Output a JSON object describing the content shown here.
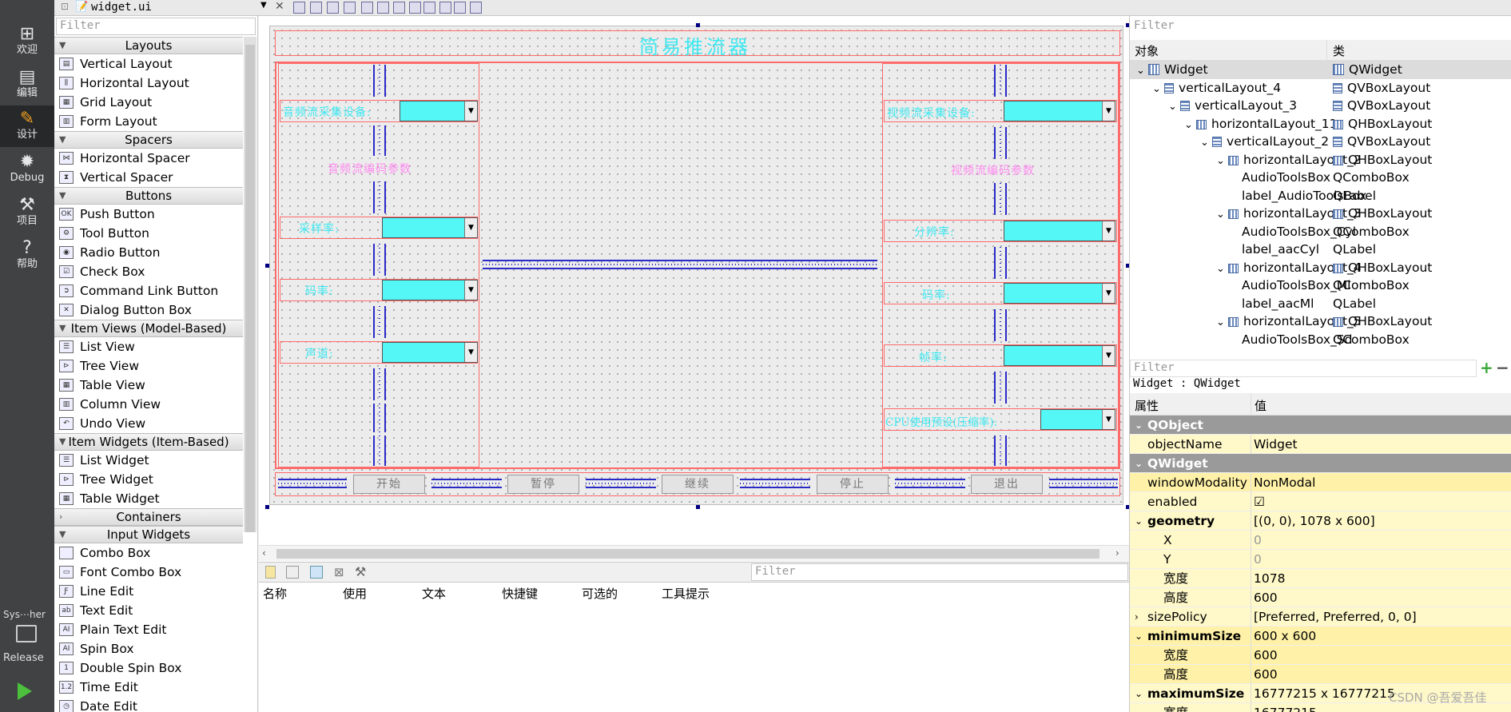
{
  "modebar": {
    "items": [
      {
        "icon": "grid-icon",
        "label": "欢迎"
      },
      {
        "icon": "edit-icon",
        "label": "编辑"
      },
      {
        "icon": "pencil-icon",
        "label": "设计"
      },
      {
        "icon": "bug-icon",
        "label": "Debug"
      },
      {
        "icon": "wrench-icon",
        "label": "项目"
      },
      {
        "icon": "help-icon",
        "label": "帮助"
      }
    ],
    "kit_label": "Sys⋯her",
    "build_label": "Release"
  },
  "topbar": {
    "file_name": "widget.ui"
  },
  "widgetbox": {
    "filter_placeholder": "Filter",
    "categories": [
      {
        "name": "Layouts",
        "items": [
          "Vertical Layout",
          "Horizontal Layout",
          "Grid Layout",
          "Form Layout"
        ]
      },
      {
        "name": "Spacers",
        "items": [
          "Horizontal Spacer",
          "Vertical Spacer"
        ]
      },
      {
        "name": "Buttons",
        "items": [
          "Push Button",
          "Tool Button",
          "Radio Button",
          "Check Box",
          "Command Link Button",
          "Dialog Button Box"
        ]
      },
      {
        "name": "Item Views (Model-Based)",
        "items": [
          "List View",
          "Tree View",
          "Table View",
          "Column View",
          "Undo View"
        ]
      },
      {
        "name": "Item Widgets (Item-Based)",
        "items": [
          "List Widget",
          "Tree Widget",
          "Table Widget"
        ]
      },
      {
        "name": "Containers",
        "items": []
      },
      {
        "name": "Input Widgets",
        "items": [
          "Combo Box",
          "Font Combo Box",
          "Line Edit",
          "Text Edit",
          "Plain Text Edit",
          "Spin Box",
          "Double Spin Box",
          "Time Edit",
          "Date Edit"
        ]
      }
    ]
  },
  "form": {
    "title": "简易推流器",
    "audio_device_label": "音频流采集设备:",
    "audio_params_label": "音频流编码参数",
    "sample_rate_label": "采样率:",
    "audio_bitrate_label": "码率:",
    "channels_label": "声道:",
    "video_device_label": "视频流采集设备:",
    "video_params_label": "视频流编码参数",
    "resolution_label": "分辨率:",
    "video_bitrate_label": "码率:",
    "framerate_label": "帧率:",
    "cpu_label": "CPU使用预设(压缩率):",
    "buttons": [
      "开始",
      "暂停",
      "继续",
      "停止",
      "退出"
    ]
  },
  "actioneditor": {
    "filter_placeholder": "Filter",
    "columns": [
      "名称",
      "使用",
      "文本",
      "快捷键",
      "可选的",
      "工具提示"
    ]
  },
  "objectinspector": {
    "filter_placeholder": "Filter",
    "columns": [
      "对象",
      "类"
    ],
    "rows": [
      {
        "name": "Widget",
        "class": "QWidget"
      },
      {
        "name": "verticalLayout_4",
        "class": "QVBoxLayout"
      },
      {
        "name": "verticalLayout_3",
        "class": "QVBoxLayout"
      },
      {
        "name": "horizontalLayout_11",
        "class": "QHBoxLayout"
      },
      {
        "name": "verticalLayout_2",
        "class": "QVBoxLayout"
      },
      {
        "name": "horizontalLayout_2",
        "class": "QHBoxLayout"
      },
      {
        "name": "AudioToolsBox",
        "class": "QComboBox"
      },
      {
        "name": "label_AudioToolsBox",
        "class": "QLabel"
      },
      {
        "name": "horizontalLayout_3",
        "class": "QHBoxLayout"
      },
      {
        "name": "AudioToolsBox_Cyl",
        "class": "QComboBox"
      },
      {
        "name": "label_aacCyl",
        "class": "QLabel"
      },
      {
        "name": "horizontalLayout_4",
        "class": "QHBoxLayout"
      },
      {
        "name": "AudioToolsBox_Ml",
        "class": "QComboBox"
      },
      {
        "name": "label_aacMl",
        "class": "QLabel"
      },
      {
        "name": "horizontalLayout_5",
        "class": "QHBoxLayout"
      },
      {
        "name": "AudioToolsBox_Sd",
        "class": "QComboBox"
      }
    ]
  },
  "propertyeditor": {
    "filter_placeholder": "Filter",
    "caption": "Widget : QWidget",
    "columns": [
      "属性",
      "值"
    ],
    "rows": [
      {
        "name": "QObject",
        "value": ""
      },
      {
        "name": "objectName",
        "value": "Widget"
      },
      {
        "name": "QWidget",
        "value": ""
      },
      {
        "name": "windowModality",
        "value": "NonModal"
      },
      {
        "name": "enabled",
        "value": "☑"
      },
      {
        "name": "geometry",
        "value": "[(0, 0), 1078 x 600]"
      },
      {
        "name": "X",
        "value": "0"
      },
      {
        "name": "Y",
        "value": "0"
      },
      {
        "name": "宽度",
        "value": "1078"
      },
      {
        "name": "高度",
        "value": "600"
      },
      {
        "name": "sizePolicy",
        "value": "[Preferred, Preferred, 0, 0]"
      },
      {
        "name": "minimumSize",
        "value": "600 x 600"
      },
      {
        "name": "宽度",
        "value": "600"
      },
      {
        "name": "高度",
        "value": "600"
      },
      {
        "name": "maximumSize",
        "value": "16777215 x 16777215"
      },
      {
        "name": "宽度",
        "value": "16777215"
      }
    ]
  },
  "watermark": "CSDN @吾爱吾佳",
  "colors": {
    "combo_fill": "#55f6f6",
    "label_cyan": "#3ee8f0",
    "label_pink": "#ff8cf0",
    "layout_red": "#ff6a6a",
    "spacer_blue": "#2a2ac8",
    "modebar_bg": "#404244"
  }
}
